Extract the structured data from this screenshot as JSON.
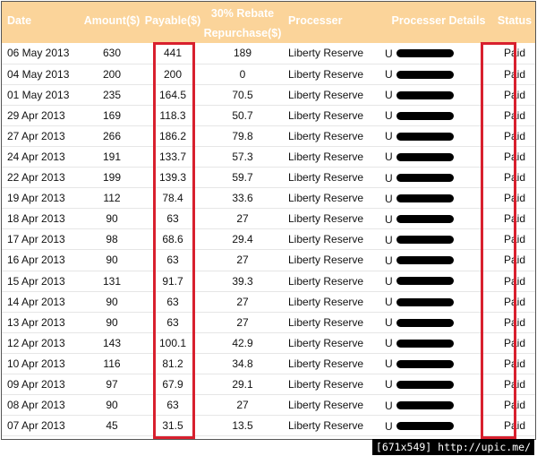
{
  "table": {
    "headers": {
      "date": "Date",
      "amount": "Amount($)",
      "payable": "Payable($)",
      "rebate_line1": "30% Rebate",
      "rebate_line2": "Repurchase($)",
      "processer": "Processer",
      "details": "Processer Details",
      "status": "Status"
    },
    "rows": [
      {
        "date": "06 May 2013",
        "amount": "630",
        "payable": "441",
        "rebate": "189",
        "processer": "Liberty Reserve",
        "detail_prefix": "U",
        "status": "Paid"
      },
      {
        "date": "04 May 2013",
        "amount": "200",
        "payable": "200",
        "rebate": "0",
        "processer": "Liberty Reserve",
        "detail_prefix": "U",
        "status": "Paid"
      },
      {
        "date": "01 May 2013",
        "amount": "235",
        "payable": "164.5",
        "rebate": "70.5",
        "processer": "Liberty Reserve",
        "detail_prefix": "U",
        "status": "Paid"
      },
      {
        "date": "29 Apr 2013",
        "amount": "169",
        "payable": "118.3",
        "rebate": "50.7",
        "processer": "Liberty Reserve",
        "detail_prefix": "U",
        "status": "Paid"
      },
      {
        "date": "27 Apr 2013",
        "amount": "266",
        "payable": "186.2",
        "rebate": "79.8",
        "processer": "Liberty Reserve",
        "detail_prefix": "U",
        "status": "Paid"
      },
      {
        "date": "24 Apr 2013",
        "amount": "191",
        "payable": "133.7",
        "rebate": "57.3",
        "processer": "Liberty Reserve",
        "detail_prefix": "U",
        "status": "Paid"
      },
      {
        "date": "22 Apr 2013",
        "amount": "199",
        "payable": "139.3",
        "rebate": "59.7",
        "processer": "Liberty Reserve",
        "detail_prefix": "U",
        "status": "Paid"
      },
      {
        "date": "19 Apr 2013",
        "amount": "112",
        "payable": "78.4",
        "rebate": "33.6",
        "processer": "Liberty Reserve",
        "detail_prefix": "U",
        "status": "Paid"
      },
      {
        "date": "18 Apr 2013",
        "amount": "90",
        "payable": "63",
        "rebate": "27",
        "processer": "Liberty Reserve",
        "detail_prefix": "U",
        "status": "Paid"
      },
      {
        "date": "17 Apr 2013",
        "amount": "98",
        "payable": "68.6",
        "rebate": "29.4",
        "processer": "Liberty Reserve",
        "detail_prefix": "U",
        "status": "Paid"
      },
      {
        "date": "16 Apr 2013",
        "amount": "90",
        "payable": "63",
        "rebate": "27",
        "processer": "Liberty Reserve",
        "detail_prefix": "U",
        "status": "Paid"
      },
      {
        "date": "15 Apr 2013",
        "amount": "131",
        "payable": "91.7",
        "rebate": "39.3",
        "processer": "Liberty Reserve",
        "detail_prefix": "U",
        "status": "Paid"
      },
      {
        "date": "14 Apr 2013",
        "amount": "90",
        "payable": "63",
        "rebate": "27",
        "processer": "Liberty Reserve",
        "detail_prefix": "U",
        "status": "Paid"
      },
      {
        "date": "13 Apr 2013",
        "amount": "90",
        "payable": "63",
        "rebate": "27",
        "processer": "Liberty Reserve",
        "detail_prefix": "U",
        "status": "Paid"
      },
      {
        "date": "12 Apr 2013",
        "amount": "143",
        "payable": "100.1",
        "rebate": "42.9",
        "processer": "Liberty Reserve",
        "detail_prefix": "U",
        "status": "Paid"
      },
      {
        "date": "10 Apr 2013",
        "amount": "116",
        "payable": "81.2",
        "rebate": "34.8",
        "processer": "Liberty Reserve",
        "detail_prefix": "U",
        "status": "Paid"
      },
      {
        "date": "09 Apr 2013",
        "amount": "97",
        "payable": "67.9",
        "rebate": "29.1",
        "processer": "Liberty Reserve",
        "detail_prefix": "U",
        "status": "Paid"
      },
      {
        "date": "08 Apr 2013",
        "amount": "90",
        "payable": "63",
        "rebate": "27",
        "processer": "Liberty Reserve",
        "detail_prefix": "U",
        "status": "Paid"
      },
      {
        "date": "07 Apr 2013",
        "amount": "45",
        "payable": "31.5",
        "rebate": "13.5",
        "processer": "Liberty Reserve",
        "detail_prefix": "U",
        "status": "Paid"
      }
    ]
  },
  "footer": {
    "text": "[671x549] http://upic.me/"
  },
  "colors": {
    "header_bg": "#fbd49a",
    "header_text": "#ffffff",
    "highlight": "#d8202e",
    "redaction": "#000000"
  }
}
